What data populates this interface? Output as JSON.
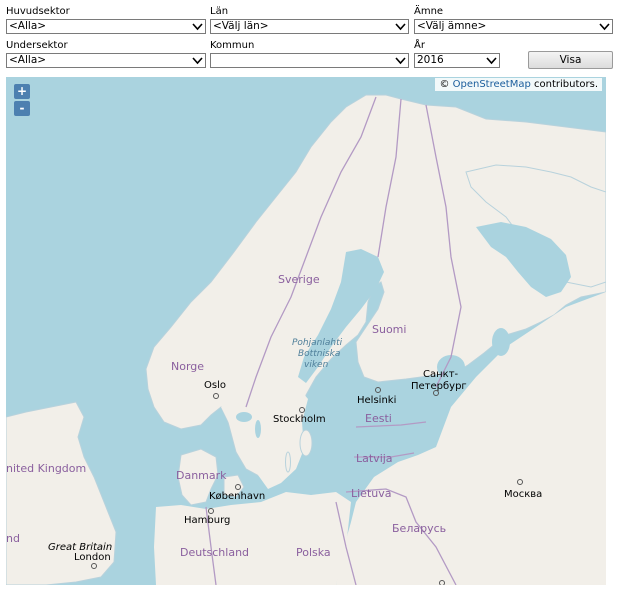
{
  "filters": {
    "huvudsektor": {
      "label": "Huvudsektor",
      "value": "<Alla>"
    },
    "lan": {
      "label": "Län",
      "value": "<Välj län>"
    },
    "amne": {
      "label": "Ämne",
      "value": "<Välj ämne>"
    },
    "undersektor": {
      "label": "Undersektor",
      "value": "<Alla>"
    },
    "kommun": {
      "label": "Kommun",
      "value": ""
    },
    "ar": {
      "label": "År",
      "value": "2016"
    },
    "show_label": "Visa"
  },
  "map": {
    "zoom_in": "+",
    "zoom_out": "-",
    "attribution": {
      "prefix": "© ",
      "link": "OpenStreetMap",
      "suffix": " contributors."
    },
    "place_labels": {
      "sverige": "Sverige",
      "norge": "Norge",
      "suomi": "Suomi",
      "oslo": "Oslo",
      "stockholm": "Stockholm",
      "helsinki": "Helsinki",
      "spb1": "Санкт-",
      "spb2": "Петербург",
      "eesti": "Eesti",
      "latvija": "Latvija",
      "lietuva": "Lietuva",
      "danmark": "Danmark",
      "kobenhavn": "København",
      "hamburg": "Hamburg",
      "deutschland": "Deutschland",
      "polska": "Polska",
      "belarus": "Беларусь",
      "moskva": "Москва",
      "united_kingdom": "nited Kingdom",
      "great_britain": "Great Britain",
      "london": "London",
      "pohjanlahti": "Pohjanlahti",
      "bottniska": "Bottniska",
      "viken": "viken",
      "edge_nd": "nd"
    },
    "colors": {
      "water": "#aad3df",
      "land": "#f2efe9",
      "border": "#b39ac4",
      "label": "#8a5f9e"
    }
  }
}
